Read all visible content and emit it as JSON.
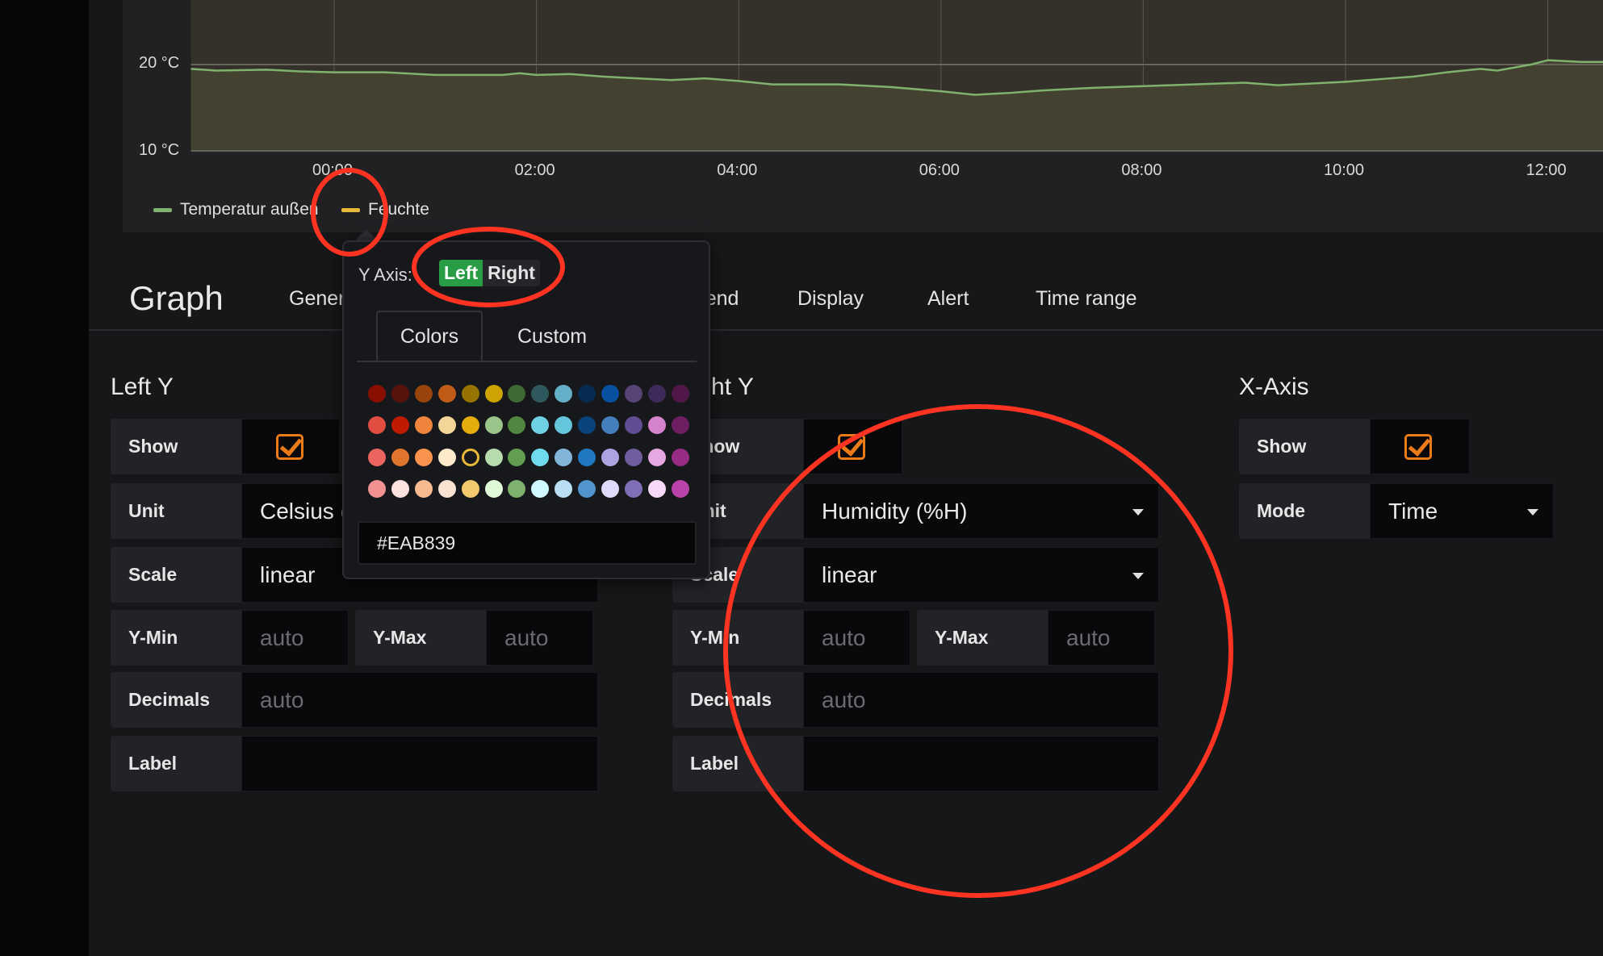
{
  "colors": {
    "accent_check": "#eb7b18",
    "annotation": "#ff3322",
    "toggle_active": "#299c46",
    "series_temp": "#7eb26d",
    "series_humidity": "#eab839"
  },
  "chart_data": {
    "type": "area",
    "y_ticks": [
      "20 °C",
      "10 °C"
    ],
    "ylim": [
      10,
      27.5
    ],
    "x_ticks": [
      "00:00",
      "02:00",
      "04:00",
      "06:00",
      "08:00",
      "10:00",
      "12:00"
    ],
    "xlim": [
      "22:35",
      "12:33"
    ],
    "grid": true,
    "legend_position": "bottom-left",
    "series": [
      {
        "name": "Temperatur außen",
        "color": "#7eb26d",
        "x": [
          "22:35",
          "22:50",
          "23:20",
          "23:40",
          "00:00",
          "00:30",
          "01:00",
          "01:40",
          "01:50",
          "02:00",
          "02:20",
          "02:40",
          "03:00",
          "03:20",
          "03:40",
          "04:00",
          "04:20",
          "05:00",
          "05:30",
          "06:00",
          "06:20",
          "06:40",
          "07:00",
          "07:30",
          "08:00",
          "08:30",
          "09:00",
          "09:20",
          "09:40",
          "10:00",
          "10:20",
          "10:40",
          "11:00",
          "11:20",
          "11:30",
          "11:50",
          "12:00",
          "12:20",
          "12:33"
        ],
        "y": [
          19.5,
          19.3,
          19.4,
          19.2,
          19.1,
          19.1,
          18.8,
          18.8,
          19.0,
          18.8,
          18.9,
          18.6,
          18.4,
          18.2,
          18.4,
          18.1,
          17.7,
          17.7,
          17.4,
          16.9,
          16.5,
          16.7,
          17.0,
          17.3,
          17.5,
          17.7,
          17.9,
          17.6,
          17.8,
          18.0,
          18.3,
          18.6,
          19.1,
          19.5,
          19.3,
          20.0,
          20.5,
          20.3,
          20.3
        ]
      },
      {
        "name": "Feuchte",
        "color": "#eab839",
        "x": [],
        "y": []
      }
    ]
  },
  "editor": {
    "title": "Graph",
    "tabs": [
      "General",
      "Legend",
      "Display",
      "Alert",
      "Time range"
    ]
  },
  "left_y": {
    "heading": "Left Y",
    "show_label": "Show",
    "show": true,
    "unit_label": "Unit",
    "unit": "Celsius (°C)",
    "scale_label": "Scale",
    "scale": "linear",
    "ymin_label": "Y-Min",
    "ymin_placeholder": "auto",
    "ymax_label": "Y-Max",
    "ymax_placeholder": "auto",
    "decimals_label": "Decimals",
    "decimals_placeholder": "auto",
    "label_label": "Label",
    "label_value": ""
  },
  "right_y": {
    "heading": "Right Y",
    "show_label": "Show",
    "show": true,
    "unit_label": "Unit",
    "unit": "Humidity (%H)",
    "scale_label": "Scale",
    "scale": "linear",
    "ymin_label": "Y-Min",
    "ymin_placeholder": "auto",
    "ymax_label": "Y-Max",
    "ymax_placeholder": "auto",
    "decimals_label": "Decimals",
    "decimals_placeholder": "auto",
    "label_label": "Label",
    "label_value": ""
  },
  "x_axis": {
    "heading": "X-Axis",
    "show_label": "Show",
    "show": true,
    "mode_label": "Mode",
    "mode": "Time"
  },
  "color_popup": {
    "y_axis_label": "Y Axis:",
    "left": "Left",
    "right": "Right",
    "active_axis": "Left",
    "tabs": [
      "Colors",
      "Custom"
    ],
    "active_tab": "Colors",
    "hex_value": "#EAB839",
    "selected": "#eab839",
    "palette": [
      [
        "#890f02",
        "#58140c",
        "#99440a",
        "#c15c17",
        "#967302",
        "#cca300",
        "#3f6833",
        "#2f575e",
        "#64b0c8",
        "#052b51",
        "#0a50a1",
        "#584477",
        "#3f2b5b",
        "#511749"
      ],
      [
        "#e24d42",
        "#bf1b00",
        "#ef843c",
        "#f4d598",
        "#e5ac0e",
        "#9ac48a",
        "#508642",
        "#6ed0e0",
        "#65c5db",
        "#0a437c",
        "#447ebc",
        "#614d93",
        "#d683ce",
        "#6d1f62"
      ],
      [
        "#ea6460",
        "#e0752d",
        "#f9934e",
        "#fceaca",
        "#eab839",
        "#b7dbab",
        "#629e51",
        "#70dbed",
        "#82b5d8",
        "#1f78c1",
        "#aea2e0",
        "#705da0",
        "#e5a8e2",
        "#962d82"
      ],
      [
        "#f29191",
        "#fce2de",
        "#f9ba8f",
        "#f9e2d2",
        "#f2c96d",
        "#e0f9d7",
        "#7eb26d",
        "#cffaff",
        "#badff4",
        "#5195ce",
        "#dedaf7",
        "#806eb7",
        "#f9d9f9",
        "#ba43a9"
      ]
    ]
  }
}
